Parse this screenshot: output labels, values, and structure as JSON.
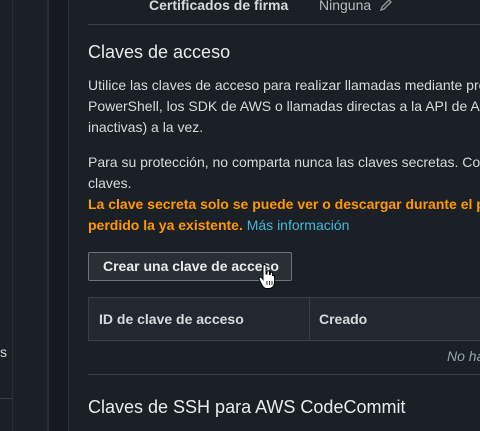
{
  "signature": {
    "label": "Certificados de firma",
    "value": "Ninguna",
    "edit_icon": "pencil-icon"
  },
  "access_keys": {
    "title": "Claves de acceso",
    "description_lines": [
      "Utilice las claves de acceso para realizar llamadas mediante pro",
      "PowerShell, los SDK de AWS o llamadas directas a la API de A",
      "inactivas) a la vez."
    ],
    "protection_lines": [
      "Para su protección, no comparta nunca las claves secretas. Co",
      "claves."
    ],
    "warning_line1": "La clave secreta solo se puede ver o descargar durante el p",
    "warning_line2": "perdido la ya existente.",
    "more_info_link": "Más información",
    "create_button": "Crear una clave de acceso",
    "table": {
      "columns": [
        "ID de clave de acceso",
        "Creado"
      ],
      "empty_text": "No ha"
    }
  },
  "ssh_keys": {
    "title": "Claves de SSH para AWS CodeCommit"
  },
  "left_nav": {
    "fragment": "s"
  },
  "colors": {
    "background": "#16191f",
    "panel": "#1b1f26",
    "warning": "#ff9900",
    "link": "#44b9d6"
  }
}
